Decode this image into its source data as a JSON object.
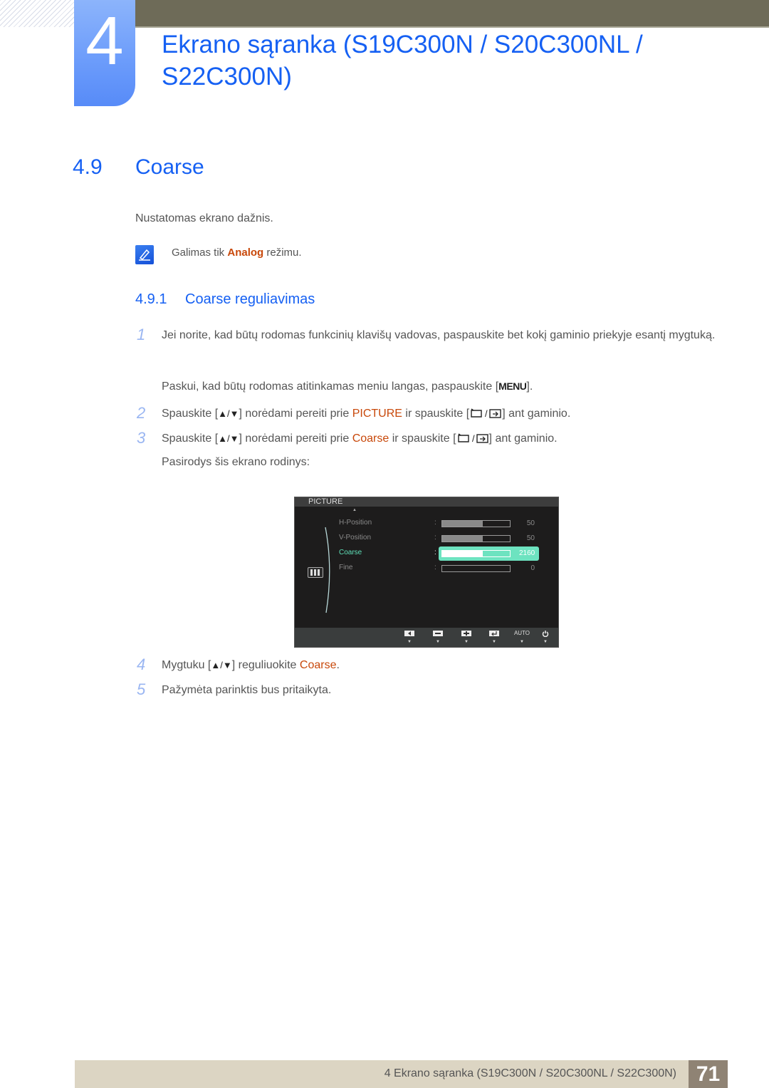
{
  "chapter": {
    "number": "4",
    "title": "Ekrano sąranka (S19C300N / S20C300NL / S22C300N)"
  },
  "section": {
    "number": "4.9",
    "title": "Coarse",
    "intro": "Nustatomas ekrano dažnis.",
    "note": {
      "icon": "note-pencil-icon",
      "before": "Galimas tik ",
      "highlight": "Analog",
      "after": " režimu."
    }
  },
  "subsection": {
    "number": "4.9.1",
    "title": "Coarse reguliavimas"
  },
  "steps": [
    {
      "num": "1",
      "text": "Jei norite, kad būtų rodomas funkcinių klavišų vadovas, paspauskite bet kokį gaminio priekyje esantį mygtuką.",
      "extra_before": "Paskui, kad būtų rodomas atitinkamas meniu langas, paspauskite [",
      "extra_key": "MENU",
      "extra_after": "]."
    },
    {
      "num": "2",
      "before": "Spauskite [",
      "keys": "▲/▼",
      "middle": "] norėdami pereiti prie ",
      "highlight": "PICTURE",
      "after_hl": " ir spauskite [",
      "end": "] ant gaminio."
    },
    {
      "num": "3",
      "before": "Spauskite [",
      "keys": "▲/▼",
      "middle": "] norėdami pereiti prie ",
      "highlight": "Coarse",
      "after_hl": " ir spauskite [",
      "end": "] ant gaminio.",
      "extra": "Pasirodys šis ekrano rodinys:"
    },
    {
      "num": "4",
      "before": "Mygtuku [",
      "keys": "▲/▼",
      "middle": "] reguliuokite ",
      "highlight": "Coarse",
      "end": "."
    },
    {
      "num": "5",
      "text": "Pažymėta parinktis bus pritaikyta."
    }
  ],
  "osd": {
    "header": "PICTURE",
    "items": [
      {
        "label": "H-Position",
        "value": "50",
        "fill_fraction": 0.6,
        "active": false
      },
      {
        "label": "V-Position",
        "value": "50",
        "fill_fraction": 0.6,
        "active": false
      },
      {
        "label": "Coarse",
        "value": "2160",
        "fill_fraction": 0.6,
        "active": true
      },
      {
        "label": "Fine",
        "value": "0",
        "fill_fraction": 0.0,
        "active": false
      }
    ],
    "buttons": [
      {
        "name": "left-button",
        "icon": "left-arrow-icon"
      },
      {
        "name": "minus-button",
        "icon": "minus-icon"
      },
      {
        "name": "plus-button",
        "icon": "plus-icon"
      },
      {
        "name": "enter-button",
        "icon": "enter-icon"
      },
      {
        "name": "auto-button",
        "label": "AUTO"
      },
      {
        "name": "power-button",
        "icon": "power-icon"
      }
    ]
  },
  "footer": {
    "text": "4 Ekrano sąranka (S19C300N / S20C300NL / S22C300N)",
    "page": "71"
  },
  "colors": {
    "heading_blue": "#1560f3",
    "highlight_orange": "#c8480a",
    "osd_active": "#6de3c0"
  }
}
